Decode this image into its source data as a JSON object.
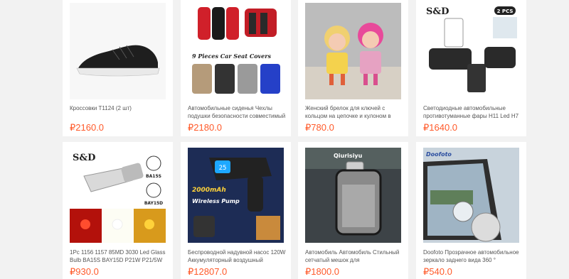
{
  "currency_symbol": "₽",
  "products": [
    {
      "title": "Кроссовки T1124  (2 шт)",
      "price": "₽2160.0",
      "image_icon": "sneaker-image"
    },
    {
      "title": "Автомобильные сиденья Чехлы подушки безопасности совместимый",
      "price": "₽2180.0",
      "image_icon": "car-seat-covers-image",
      "image_text": "9 Pieces Car Seat Covers"
    },
    {
      "title": "Женский брелок для ключей с кольцом на цепочке и кулоном в",
      "price": "₽780.0",
      "image_icon": "doll-keychain-image"
    },
    {
      "title": "Светодиодные автомобильные противотуманные фары H11 Led H7",
      "price": "₽1640.0",
      "image_icon": "led-fog-bulbs-image",
      "image_text": [
        "S&D",
        "2 PCS"
      ]
    },
    {
      "title": "1Pc 1156 1157 85MD 3030 Led Glass Bulb BA15S BAY15D P21W P21/5W LED",
      "price": "₽930.0",
      "image_icon": "led-bulb-image",
      "image_text": [
        "S&D",
        "BA15S",
        "BAY15D"
      ]
    },
    {
      "title": "Беспроводной надувной насос 120W Аккумуляторный воздушный",
      "price": "₽12807.0",
      "image_icon": "wireless-pump-image",
      "image_text": [
        "2000mAh",
        "Wireless Pump"
      ]
    },
    {
      "title": "Автомобиль Автомобиль Стильный сетчатый мешок для",
      "price": "₽1800.0",
      "image_icon": "car-mesh-bag-image",
      "image_text": "Qiurisiyu"
    },
    {
      "title": "Doofoto Прозрачное автомобильное зеркало заднего вида 360 °",
      "price": "₽540.0",
      "image_icon": "blind-spot-mirror-image",
      "image_text": "Doofoto"
    }
  ]
}
